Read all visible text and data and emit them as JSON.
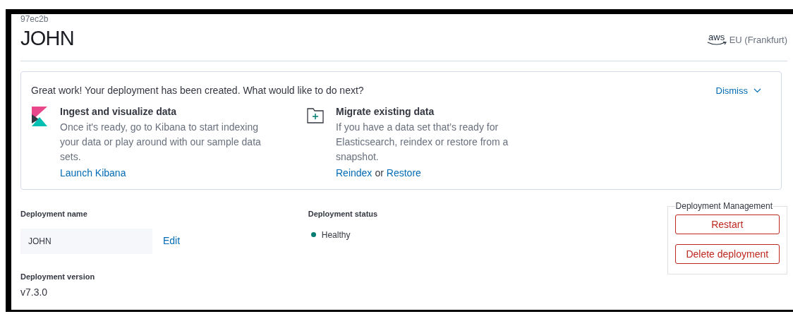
{
  "header": {
    "id": "97ec2b",
    "title": "JOHN",
    "provider": "aws",
    "region": "EU (Frankfurt)"
  },
  "callout": {
    "message": "Great work! Your deployment has been created. What would like to do next?",
    "dismiss": "Dismiss",
    "items": [
      {
        "kind": "kibana",
        "title": "Ingest and visualize data",
        "description": "Once it's ready, go to Kibana to start indexing your data or play around with our sample data sets.",
        "links": [
          "Launch Kibana"
        ]
      },
      {
        "kind": "folder",
        "title": "Migrate existing data",
        "description": "If you have a data set that’s ready for Elasticsearch, reindex or restore from a snapshot.",
        "links": [
          "Reindex",
          "Restore"
        ],
        "link_separator": "or"
      }
    ]
  },
  "details": {
    "name_label": "Deployment name",
    "name_value": "JOHN",
    "edit": "Edit",
    "status_label": "Deployment status",
    "status": {
      "label": "Healthy",
      "color": "#017d73"
    },
    "version_label": "Deployment version",
    "version": "v7.3.0"
  },
  "management": {
    "legend": "Deployment Management",
    "buttons": [
      "Restart",
      "Delete deployment"
    ]
  }
}
